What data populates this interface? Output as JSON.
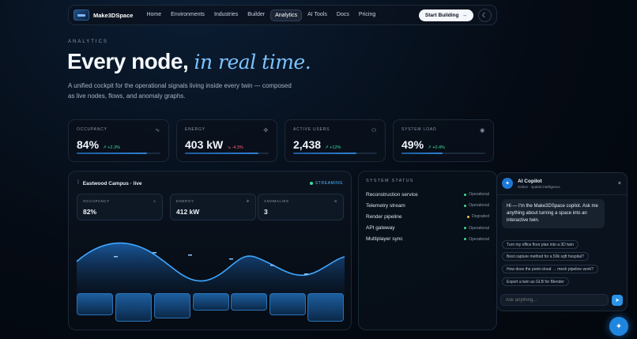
{
  "nav": {
    "brand": "Make3DSpace",
    "links": [
      "Home",
      "Environments",
      "Industries",
      "Builder",
      "Analytics",
      "AI Tools",
      "Docs",
      "Pricing"
    ],
    "active": "Analytics",
    "cta": "Start Building",
    "cta_arrow": "→",
    "theme_icon": "☾"
  },
  "hero": {
    "eyebrow": "ANALYTICS",
    "title_plain": "Every node,",
    "title_italic": "in real time.",
    "subtitle": "A unified cockpit for the operational signals living inside every twin — composed as live nodes, flows, and anomaly graphs."
  },
  "stats": [
    {
      "label": "OCCUPANCY",
      "value": "84%",
      "delta": "↗ +2.3%",
      "dir": "up",
      "icon": "activity-icon",
      "glyph": "∿",
      "fill": 0.84
    },
    {
      "label": "ENERGY",
      "value": "403 kW",
      "delta": "↘ -4.3%",
      "dir": "down",
      "icon": "energy-icon",
      "glyph": "✣",
      "fill": 0.88
    },
    {
      "label": "ACTIVE USERS",
      "value": "2,438",
      "delta": "↗ +12%",
      "dir": "up",
      "icon": "users-icon",
      "glyph": "⚇",
      "fill": 0.75
    },
    {
      "label": "SYSTEM LOAD",
      "value": "49%",
      "delta": "↗ +0.4%",
      "dir": "up",
      "icon": "gauge-icon",
      "glyph": "◉",
      "fill": 0.49
    }
  ],
  "campus": {
    "title": "Eastwood Campus · live",
    "streaming": "STREAMING",
    "minis": [
      {
        "label": "OCCUPANCY",
        "value": "82%",
        "glyph": "∿"
      },
      {
        "label": "ENERGY",
        "value": "412 kW",
        "glyph": "✣"
      },
      {
        "label": "ANOMALIES",
        "value": "3",
        "glyph": "⊘"
      }
    ]
  },
  "system_status": {
    "title": "SYSTEM STATUS",
    "rows": [
      {
        "name": "Reconstruction service",
        "state": "Operational",
        "color": "#3ddc97"
      },
      {
        "name": "Telemetry stream",
        "state": "Operational",
        "color": "#3ddc97"
      },
      {
        "name": "Render pipeline",
        "state": "Degraded",
        "color": "#f2c04b"
      },
      {
        "name": "API gateway",
        "state": "Operational",
        "color": "#3ddc97"
      },
      {
        "name": "Multiplayer sync",
        "state": "Operational",
        "color": "#3ddc97"
      }
    ]
  },
  "copilot": {
    "title": "AI Copilot",
    "subtitle": "Online · spatial intelligence",
    "close": "×",
    "message": "Hi — I'm the Make3DSpace copilot. Ask me anything about turning a space into an interactive twin.",
    "suggestions": [
      "Turn my office floor plan into a 3D twin",
      "Best capture method for a 50k sqft hospital?",
      "How does the point-cloud → mesh pipeline work?",
      "Export a twin as GLB for Blender"
    ],
    "input_placeholder": "Ask anything...",
    "send_icon": "➤"
  },
  "fab_icon": "✦",
  "colors": {
    "accent": "#2f8fe8",
    "up": "#3ddc97",
    "down": "#ff5a6e",
    "degraded": "#f2c04b"
  }
}
